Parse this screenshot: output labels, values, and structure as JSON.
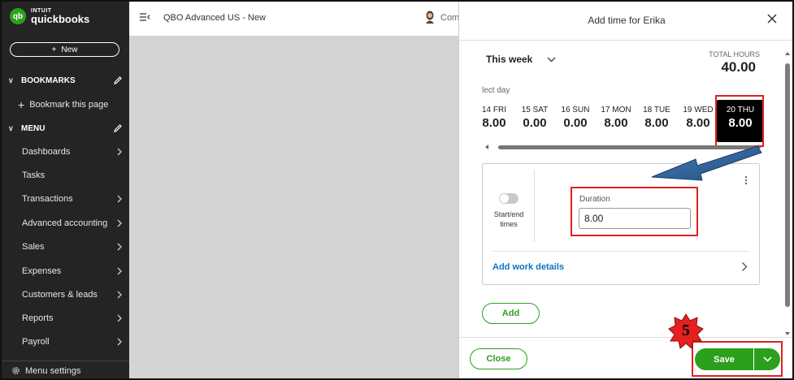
{
  "sidebar": {
    "logo": {
      "brand": "INTUIT",
      "product": "quickbooks",
      "mark": "qb"
    },
    "new_button": "New",
    "bookmarks_header": "BOOKMARKS",
    "bookmark_this_page": "Bookmark this page",
    "menu_header": "MENU",
    "items": [
      {
        "label": "Dashboards",
        "has_arrow": true
      },
      {
        "label": "Tasks",
        "has_arrow": false
      },
      {
        "label": "Transactions",
        "has_arrow": true
      },
      {
        "label": "Advanced accounting",
        "has_arrow": true
      },
      {
        "label": "Sales",
        "has_arrow": true
      },
      {
        "label": "Expenses",
        "has_arrow": true
      },
      {
        "label": "Customers & leads",
        "has_arrow": true
      },
      {
        "label": "Reports",
        "has_arrow": true
      },
      {
        "label": "Payroll",
        "has_arrow": true
      }
    ],
    "menu_settings": "Menu settings"
  },
  "topbar": {
    "company": "QBO Advanced US - New",
    "account_partial": "Com"
  },
  "panel": {
    "title": "Add time for Erika",
    "week_selector": "This week",
    "total_hours_label": "TOTAL HOURS",
    "total_hours_value": "40.00",
    "select_day_label": "lect day",
    "days": [
      {
        "name": "14 FRI",
        "hours": "8.00"
      },
      {
        "name": "15 SAT",
        "hours": "0.00"
      },
      {
        "name": "16 SUN",
        "hours": "0.00"
      },
      {
        "name": "17 MON",
        "hours": "8.00"
      },
      {
        "name": "18 TUE",
        "hours": "8.00"
      },
      {
        "name": "19 WED",
        "hours": "8.00"
      },
      {
        "name": "20 THU",
        "hours": "8.00"
      }
    ],
    "selected_day_index": 6,
    "toggle_label": "Start/end times",
    "duration_label": "Duration",
    "duration_value": "8.00",
    "work_details_link": "Add work details",
    "add_button": "Add",
    "close_button": "Close",
    "save_button": "Save"
  },
  "annotation": {
    "step_number": "5"
  },
  "colors": {
    "brand_green": "#2ca01c",
    "sidebar_bg": "#242424",
    "highlight_red": "#e02020",
    "arrow_blue": "#2f5f95",
    "link_blue": "#0b74c4"
  }
}
